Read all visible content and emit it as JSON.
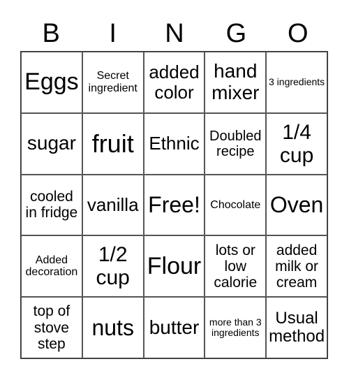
{
  "header": [
    "B",
    "I",
    "N",
    "G",
    "O"
  ],
  "cells": [
    {
      "text": "Eggs",
      "size": 34
    },
    {
      "text": "Secret ingredient",
      "size": 16
    },
    {
      "text": "added color",
      "size": 26
    },
    {
      "text": "hand mixer",
      "size": 28
    },
    {
      "text": "3 ingredients",
      "size": 14
    },
    {
      "text": "sugar",
      "size": 28
    },
    {
      "text": "fruit",
      "size": 36
    },
    {
      "text": "Ethnic",
      "size": 26
    },
    {
      "text": "Doubled recipe",
      "size": 20
    },
    {
      "text": "1/4 cup",
      "size": 30
    },
    {
      "text": "cooled in fridge",
      "size": 21
    },
    {
      "text": "vanilla",
      "size": 26
    },
    {
      "text": "Free!",
      "size": 32
    },
    {
      "text": "Chocolate",
      "size": 16
    },
    {
      "text": "Oven",
      "size": 32
    },
    {
      "text": "Added decoration",
      "size": 16
    },
    {
      "text": "1/2 cup",
      "size": 30
    },
    {
      "text": "Flour",
      "size": 34
    },
    {
      "text": "lots or low calorie",
      "size": 21
    },
    {
      "text": "added milk or cream",
      "size": 21
    },
    {
      "text": "top of stove step",
      "size": 21
    },
    {
      "text": "nuts",
      "size": 32
    },
    {
      "text": "butter",
      "size": 28
    },
    {
      "text": "more than 3 ingredients",
      "size": 14
    },
    {
      "text": "Usual method",
      "size": 24
    }
  ]
}
